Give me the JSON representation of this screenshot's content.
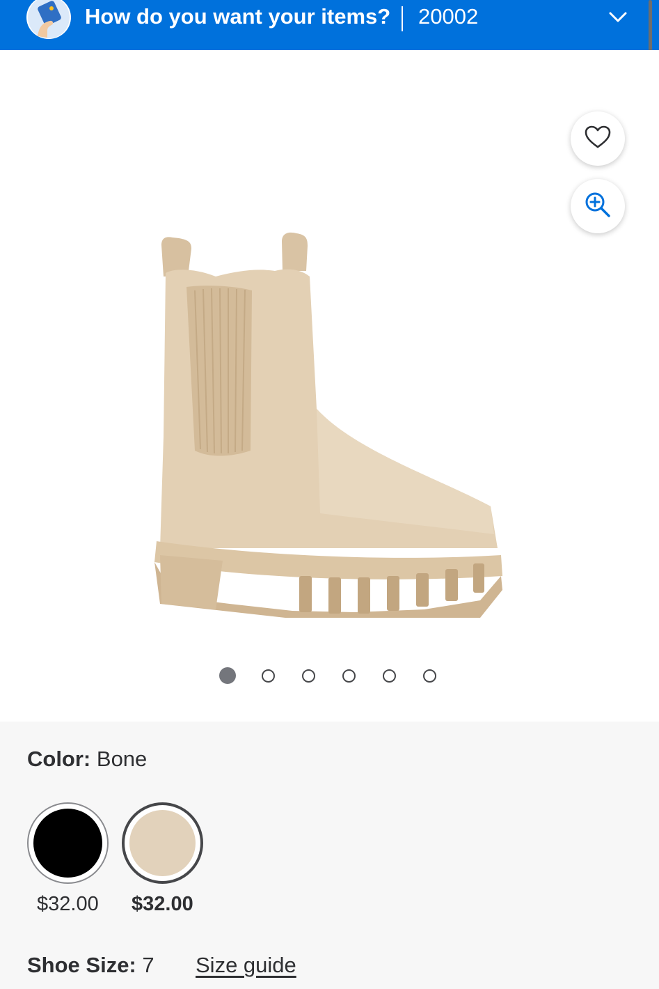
{
  "header": {
    "title": "How do you want your items?",
    "zip": "20002",
    "colors": {
      "background": "#0071dc",
      "text": "#ffffff"
    }
  },
  "product": {
    "image_alt": "Beige suede chelsea boot with lug sole",
    "gallery_count": 6,
    "active_index": 0,
    "favorite_icon": "heart-icon",
    "zoom_icon": "zoom-in-icon"
  },
  "variants": {
    "color_label": "Color:",
    "color_value": "Bone",
    "options": [
      {
        "name": "Black",
        "swatch": "#000000",
        "price": "$32.00",
        "selected": false
      },
      {
        "name": "Bone",
        "swatch": "#e2d2bb",
        "price": "$32.00",
        "selected": true
      }
    ],
    "size_label": "Shoe Size:",
    "size_value": "7",
    "size_guide": "Size guide"
  }
}
